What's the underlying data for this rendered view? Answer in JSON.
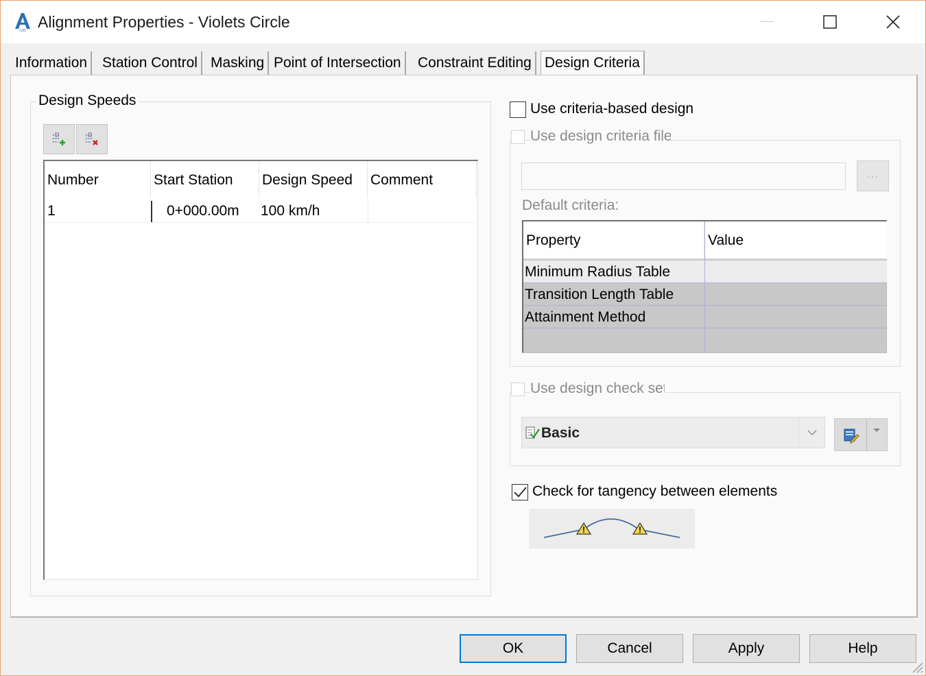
{
  "window": {
    "title": "Alignment Properties - Violets Circle",
    "app_icon": "autocad-civil-icon"
  },
  "tabs": [
    {
      "label": "Information",
      "active": false
    },
    {
      "label": "Station Control",
      "active": false
    },
    {
      "label": "Masking",
      "active": false
    },
    {
      "label": "Point of Intersection",
      "active": false
    },
    {
      "label": "Constraint Editing",
      "active": false
    },
    {
      "label": "Design Criteria",
      "active": true
    }
  ],
  "design_speeds": {
    "group_label": "Design Speeds",
    "add_icon": "add-row-icon",
    "delete_icon": "delete-row-icon",
    "columns": [
      "Number",
      "Start Station",
      "Design Speed",
      "Comment"
    ],
    "rows": [
      {
        "number": "1",
        "start_station": "0+000.00m",
        "design_speed": "100 km/h",
        "comment": ""
      }
    ]
  },
  "criteria": {
    "use_criteria_label": "Use criteria-based design",
    "use_criteria_checked": false,
    "use_file_label": "Use design criteria file",
    "use_file_checked": false,
    "file_path": "",
    "browse_label": "···",
    "default_criteria_label": "Default criteria:",
    "table_columns": [
      "Property",
      "Value"
    ],
    "table_rows": [
      {
        "property": "Minimum Radius Table",
        "value": ""
      },
      {
        "property": "Transition Length Table",
        "value": ""
      },
      {
        "property": "Attainment Method",
        "value": ""
      }
    ],
    "use_check_set_label": "Use design check set",
    "use_check_set_checked": false,
    "check_set_value": "Basic",
    "tangency_label": "Check for tangency between elements",
    "tangency_checked": true
  },
  "buttons": {
    "ok": "OK",
    "cancel": "Cancel",
    "apply": "Apply",
    "help": "Help"
  },
  "colors": {
    "accent": "#0078d7",
    "window_border": "#e8a070"
  }
}
